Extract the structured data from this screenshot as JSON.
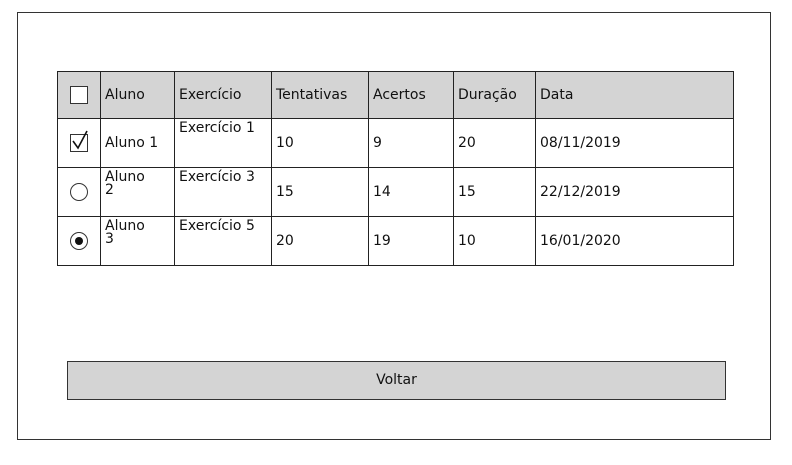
{
  "table": {
    "headers": [
      "Aluno",
      "Exercício",
      "Tentativas",
      "Acertos",
      "Duração",
      "Data"
    ],
    "rows": [
      {
        "select_state": "checked",
        "aluno": "Aluno 1",
        "exercicio": "Exercício 1",
        "tentativas": "10",
        "acertos": "9",
        "duracao": "20",
        "data": "08/11/2019"
      },
      {
        "select_state": "radio-off",
        "aluno": "Aluno 2",
        "exercicio": "Exercício 3",
        "tentativas": "15",
        "acertos": "14",
        "duracao": "15",
        "data": "22/12/2019"
      },
      {
        "select_state": "radio-on",
        "aluno": "Aluno 3",
        "exercicio": "Exercício 5",
        "tentativas": "20",
        "acertos": "19",
        "duracao": "10",
        "data": "16/01/2020"
      }
    ]
  },
  "footer": {
    "back_label": "Voltar"
  },
  "colors": {
    "header_bg": "#d4d4d4",
    "button_bg": "#d4d4d4",
    "border": "#222222"
  },
  "icons": {
    "header_select": "checkbox-icon",
    "checked": "checkbox-checked-icon",
    "radio_off": "radio-unselected-icon",
    "radio_on": "radio-selected-icon"
  }
}
